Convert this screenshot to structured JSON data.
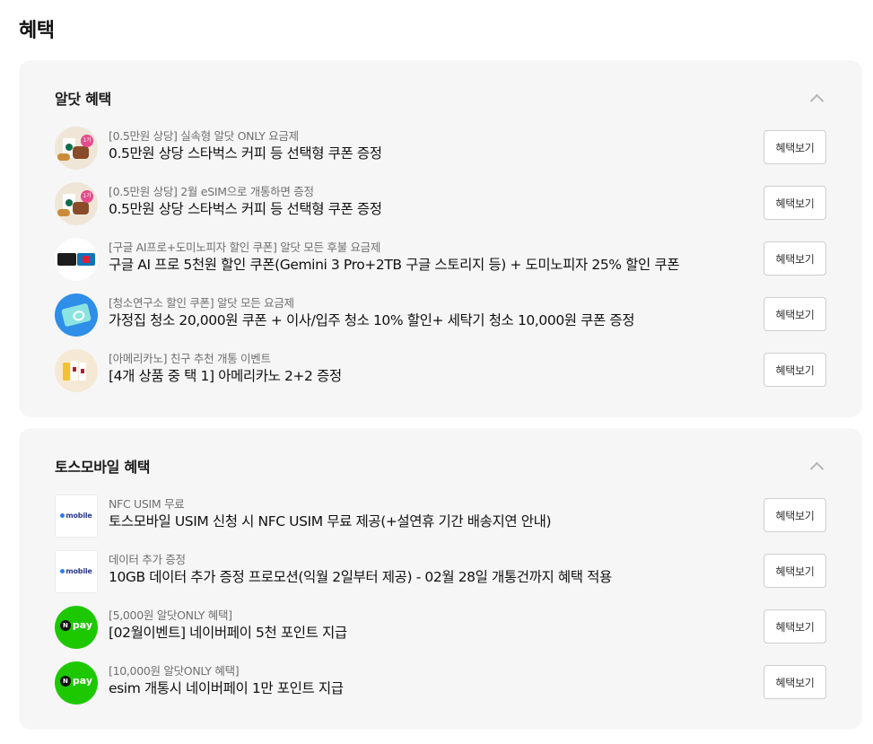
{
  "page_title": "혜택",
  "button_label": "혜택보기",
  "sections": [
    {
      "title": "알닷 혜택",
      "items": [
        {
          "sub": "[0.5만원 상당] 실속형 알닷 ONLY 요금제",
          "main": "0.5만원 상당 스타벅스 커피 등 선택형 쿠폰 증정",
          "thumb": "starbucks-coupon-thumbnail",
          "badge": "1가"
        },
        {
          "sub": "[0.5만원 상당] 2월 eSIM으로 개통하면 증정",
          "main": "0.5만원 상당 스타벅스 커피 등 선택형 쿠폰 증정",
          "thumb": "starbucks-coupon-thumbnail",
          "badge": "1가"
        },
        {
          "sub": "[구글 AI프로+도미노피자 할인 쿠폰] 알닷 모든 후불 요금제",
          "main": "구글 AI 프로 5천원 할인 쿠폰(Gemini 3 Pro+2TB 구글 스토리지 등) + 도미노피자 25% 할인 쿠폰",
          "thumb": "google-domino-thumbnail"
        },
        {
          "sub": "[청소연구소 할인 쿠폰] 알닷 모든 요금제",
          "main": "가정집 청소 20,000원 쿠폰 + 이사/입주 청소 10% 할인+ 세탁기 청소 10,000원 쿠폰 증정",
          "thumb": "cleaning-coupon-thumbnail"
        },
        {
          "sub": "[아메리카노] 친구 추천 개통 이벤트",
          "main": "[4개 상품 중 택 1] 아메리카노 2+2 증정",
          "thumb": "americano-thumbnail"
        }
      ]
    },
    {
      "title": "토스모바일 혜택",
      "items": [
        {
          "sub": "NFC USIM 무료",
          "main": "토스모바일 USIM 신청 시 NFC USIM 무료 제공(+설연휴 기간 배송지연 안내)",
          "thumb": "mobile-logo-thumbnail",
          "logo": "mobile"
        },
        {
          "sub": "데이터 추가 증정",
          "main": "10GB 데이터 추가 증정 프로모션(익월 2일부터 제공) - 02월 28일 개통건까지 혜택 적용",
          "thumb": "mobile-logo-thumbnail",
          "logo": "mobile"
        },
        {
          "sub": "[5,000원 알닷ONLY 혜택]",
          "main": "[02월이벤트] 네이버페이 5천 포인트 지급",
          "thumb": "naver-pay-thumbnail",
          "logo": "pay",
          "logo_n": "N"
        },
        {
          "sub": "[10,000원 알닷ONLY 혜택]",
          "main": "esim 개통시 네이버페이 1만 포인트 지급",
          "thumb": "naver-pay-thumbnail",
          "logo": "pay",
          "logo_n": "N"
        }
      ]
    }
  ],
  "colors": {
    "section_bg": "#f6f6f6",
    "sub_text": "#6f6f6f",
    "naver_green": "#1ec800"
  }
}
